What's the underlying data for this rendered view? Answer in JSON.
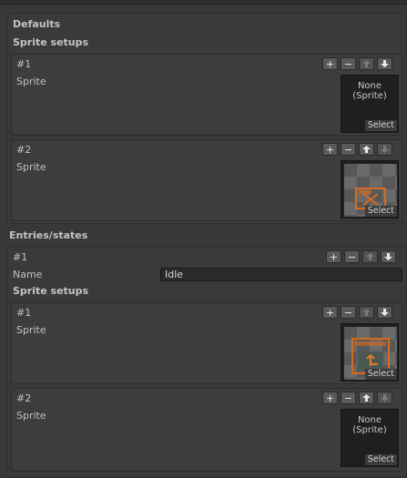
{
  "defaults": {
    "heading": "Defaults",
    "sprite_setups_label": "Sprite setups",
    "setups": [
      {
        "index": "#1",
        "field_label": "Sprite",
        "slot_empty_line1": "None",
        "slot_empty_line2": "(Sprite)",
        "select_label": "Select",
        "has_sprite": false
      },
      {
        "index": "#2",
        "field_label": "Sprite",
        "select_label": "Select",
        "has_sprite": true
      }
    ]
  },
  "entries": {
    "heading": "Entries/states",
    "items": [
      {
        "index": "#1",
        "name_label": "Name",
        "name_value": "Idle",
        "sprite_setups_label": "Sprite setups",
        "setups": [
          {
            "index": "#1",
            "field_label": "Sprite",
            "select_label": "Select",
            "has_sprite": true
          },
          {
            "index": "#2",
            "field_label": "Sprite",
            "slot_empty_line1": "None",
            "slot_empty_line2": "(Sprite)",
            "select_label": "Select",
            "has_sprite": false
          }
        ]
      }
    ]
  },
  "buttons": {
    "add": "+",
    "remove": "−"
  },
  "icons": [
    "plus-icon",
    "minus-icon",
    "arrow-up-icon",
    "arrow-down-icon"
  ],
  "colors": {
    "panel_bg": "#383838",
    "slot_bg": "#1f1f1f",
    "sprite_orange": "#d96a1e"
  }
}
